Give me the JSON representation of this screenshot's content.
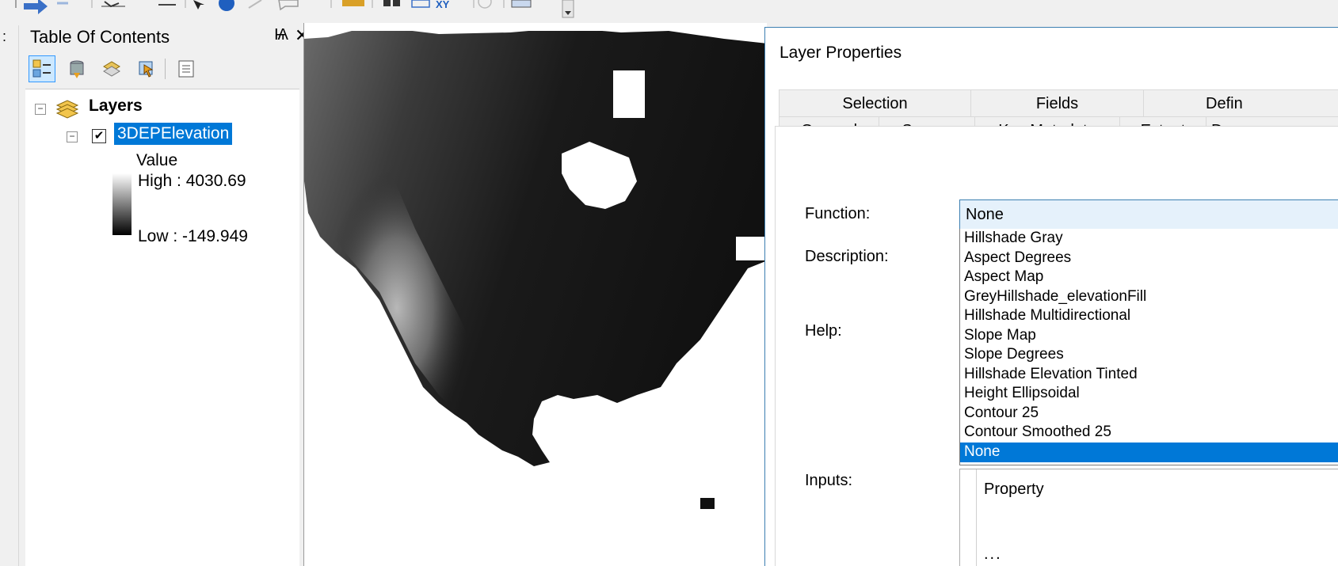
{
  "toc": {
    "title": "Table Of Contents",
    "pin_glyph": "Ѩ",
    "close_glyph": "✕",
    "tools": [
      "list-by-drawing-order-icon",
      "list-by-source-icon",
      "list-by-visibility-icon",
      "list-by-selection-icon",
      "options-icon"
    ],
    "tree": {
      "root_label": "Layers",
      "root_expander": "−",
      "layer_expander": "−",
      "layer_checkbox": "✔",
      "layer_name": "3DEPElevation",
      "legend_title": "Value",
      "legend_high": "High : 4030.69",
      "legend_low": "Low : -149.949"
    }
  },
  "toolbar": {
    "icons": [
      "back-icon",
      "forward-icon",
      "select-elements-icon",
      "identify-line-icon",
      "select-features-icon",
      "info-icon",
      "measure-icon",
      "html-popup-icon",
      "ruler-icon",
      "swipe-icon",
      "go-to-xy-icon",
      "xy-icon",
      "time-slider-icon",
      "open-time-icon",
      "toolbar-options-icon"
    ]
  },
  "dialog": {
    "title": "Layer Properties",
    "tabs_row1": [
      "Selection",
      "Fields",
      "Defin"
    ],
    "tabs_row2": [
      "General",
      "Source",
      "Key Metadata",
      "Extent",
      "D"
    ],
    "labels": {
      "function": "Function:",
      "description": "Description:",
      "help": "Help:",
      "inputs": "Inputs:"
    },
    "function_select": {
      "value": "None",
      "options": [
        "Hillshade Gray",
        "Aspect Degrees",
        "Aspect Map",
        "GreyHillshade_elevationFill",
        "Hillshade Multidirectional",
        "Slope Map",
        "Slope Degrees",
        "Hillshade Elevation Tinted",
        "Height Ellipsoidal",
        "Contour 25",
        "Contour Smoothed 25",
        "None"
      ],
      "selected_index": 11
    },
    "inputs_table": {
      "header": "Property",
      "row_hint": "..."
    }
  },
  "colors": {
    "selection": "#0078d7",
    "layer_highlight": "#0078d7",
    "dialog_border": "#3c7fb1"
  }
}
